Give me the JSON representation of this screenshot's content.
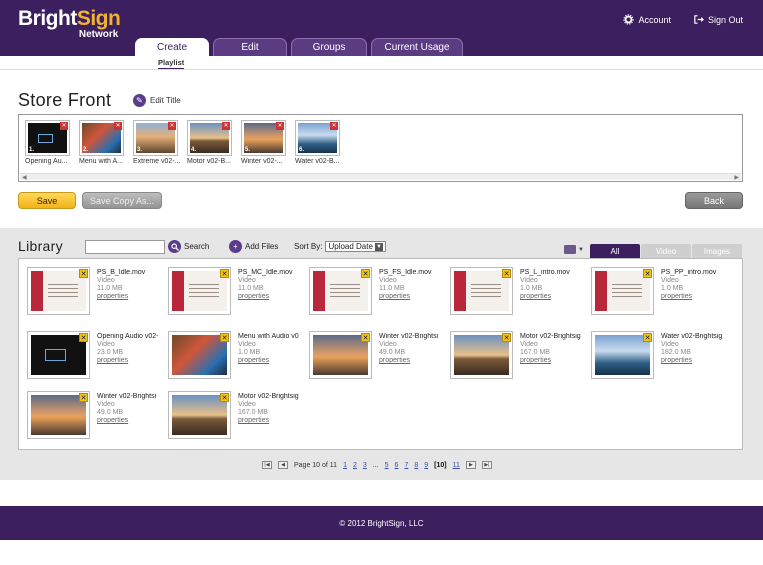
{
  "header": {
    "logo_main": "Bright",
    "logo_accent": "Sign",
    "logo_sub": "Network",
    "account_label": "Account",
    "signout_label": "Sign Out",
    "tabs": [
      {
        "label": "Create",
        "active": true
      },
      {
        "label": "Edit",
        "active": false
      },
      {
        "label": "Groups",
        "active": false
      },
      {
        "label": "Current Usage",
        "active": false
      }
    ],
    "subnav_item": "Playlist"
  },
  "playlist": {
    "title": "Store Front",
    "edit_title_label": "Edit Title",
    "items": [
      {
        "num": "1.",
        "label": "Opening Au...",
        "thumb": "gopro"
      },
      {
        "num": "2.",
        "label": "Menu with A...",
        "thumb": "menu"
      },
      {
        "num": "3.",
        "label": "Extreme v02-...",
        "thumb": "extreme"
      },
      {
        "num": "4.",
        "label": "Motor v02-B...",
        "thumb": "motor"
      },
      {
        "num": "5.",
        "label": "Winter v02-...",
        "thumb": "winter"
      },
      {
        "num": "6.",
        "label": "Water v02-B...",
        "thumb": "water"
      }
    ]
  },
  "buttons": {
    "save": "Save",
    "save_copy": "Save Copy As...",
    "back": "Back"
  },
  "library": {
    "title": "Library",
    "search_placeholder": "",
    "search_label": "Search",
    "add_files_label": "Add Files",
    "sort_by_label": "Sort By:",
    "sort_value": "Upload Date",
    "filter_tabs": [
      {
        "label": "All",
        "active": true
      },
      {
        "label": "Video",
        "active": false
      },
      {
        "label": "Images",
        "active": false
      }
    ],
    "files": [
      {
        "name": "PS_B_Idle.mov",
        "type": "Video",
        "size": "11.0 MB",
        "props": "properties",
        "thumb": "doc"
      },
      {
        "name": "PS_MC_Idle.mov",
        "type": "Video",
        "size": "11.0 MB",
        "props": "properties",
        "thumb": "doc"
      },
      {
        "name": "PS_FS_Idle.mov",
        "type": "Video",
        "size": "11.0 MB",
        "props": "properties",
        "thumb": "doc"
      },
      {
        "name": "PS_L_intro.mov",
        "type": "Video",
        "size": "1.0 MB",
        "props": "properties",
        "thumb": "doc"
      },
      {
        "name": "PS_PP_intro.mov",
        "type": "Video",
        "size": "1.0 MB",
        "props": "properties",
        "thumb": "doc"
      },
      {
        "name": "Opening Audio v02-",
        "type": "Video",
        "size": "23.0 MB",
        "props": "properties",
        "thumb": "gopro"
      },
      {
        "name": "Menu with Audio v0",
        "type": "Video",
        "size": "1.0 MB",
        "props": "properties",
        "thumb": "menu"
      },
      {
        "name": "Winter v02-Brightsi",
        "type": "Video",
        "size": "49.0 MB",
        "props": "properties",
        "thumb": "winter"
      },
      {
        "name": "Motor v02-Brightsig",
        "type": "Video",
        "size": "167.0 MB",
        "props": "properties",
        "thumb": "motor"
      },
      {
        "name": "Water v02-Brightsig",
        "type": "Video",
        "size": "182.0 MB",
        "props": "properties",
        "thumb": "water"
      },
      {
        "name": "Winter v02-Brightsi",
        "type": "Video",
        "size": "49.0 MB",
        "props": "properties",
        "thumb": "winter"
      },
      {
        "name": "Motor v02-Brightsig",
        "type": "Video",
        "size": "167.0 MB",
        "props": "properties",
        "thumb": "motor"
      }
    ]
  },
  "pager": {
    "page_text": "Page 10 of 11",
    "pages": [
      "1",
      "2",
      "3",
      "...",
      "5",
      "6",
      "7",
      "8",
      "9",
      "[10]",
      "11"
    ],
    "current": "[10]"
  },
  "footer": {
    "copyright": "© 2012 BrightSign, LLC"
  }
}
